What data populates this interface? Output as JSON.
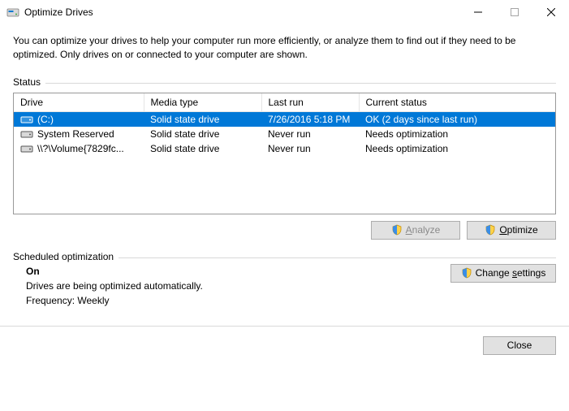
{
  "window": {
    "title": "Optimize Drives",
    "intro": "You can optimize your drives to help your computer run more efficiently, or analyze them to find out if they need to be optimized. Only drives on or connected to your computer are shown."
  },
  "status": {
    "label": "Status",
    "columns": {
      "drive": "Drive",
      "media": "Media type",
      "last": "Last run",
      "current": "Current status"
    },
    "rows": [
      {
        "drive": "(C:)",
        "media": "Solid state drive",
        "last": "7/26/2016 5:18 PM",
        "current": "OK (2 days since last run)",
        "selected": true,
        "iconColor": "#fff"
      },
      {
        "drive": "System Reserved",
        "media": "Solid state drive",
        "last": "Never run",
        "current": "Needs optimization",
        "selected": false,
        "iconColor": "#666"
      },
      {
        "drive": "\\\\?\\Volume{7829fc...",
        "media": "Solid state drive",
        "last": "Never run",
        "current": "Needs optimization",
        "selected": false,
        "iconColor": "#666"
      }
    ],
    "buttons": {
      "analyze": "Analyze",
      "optimize": "Optimize"
    }
  },
  "scheduled": {
    "label": "Scheduled optimization",
    "state": "On",
    "desc": "Drives are being optimized automatically.",
    "freqLabel": "Frequency:",
    "freqValue": "Weekly",
    "button": "Change settings"
  },
  "footer": {
    "close": "Close"
  }
}
